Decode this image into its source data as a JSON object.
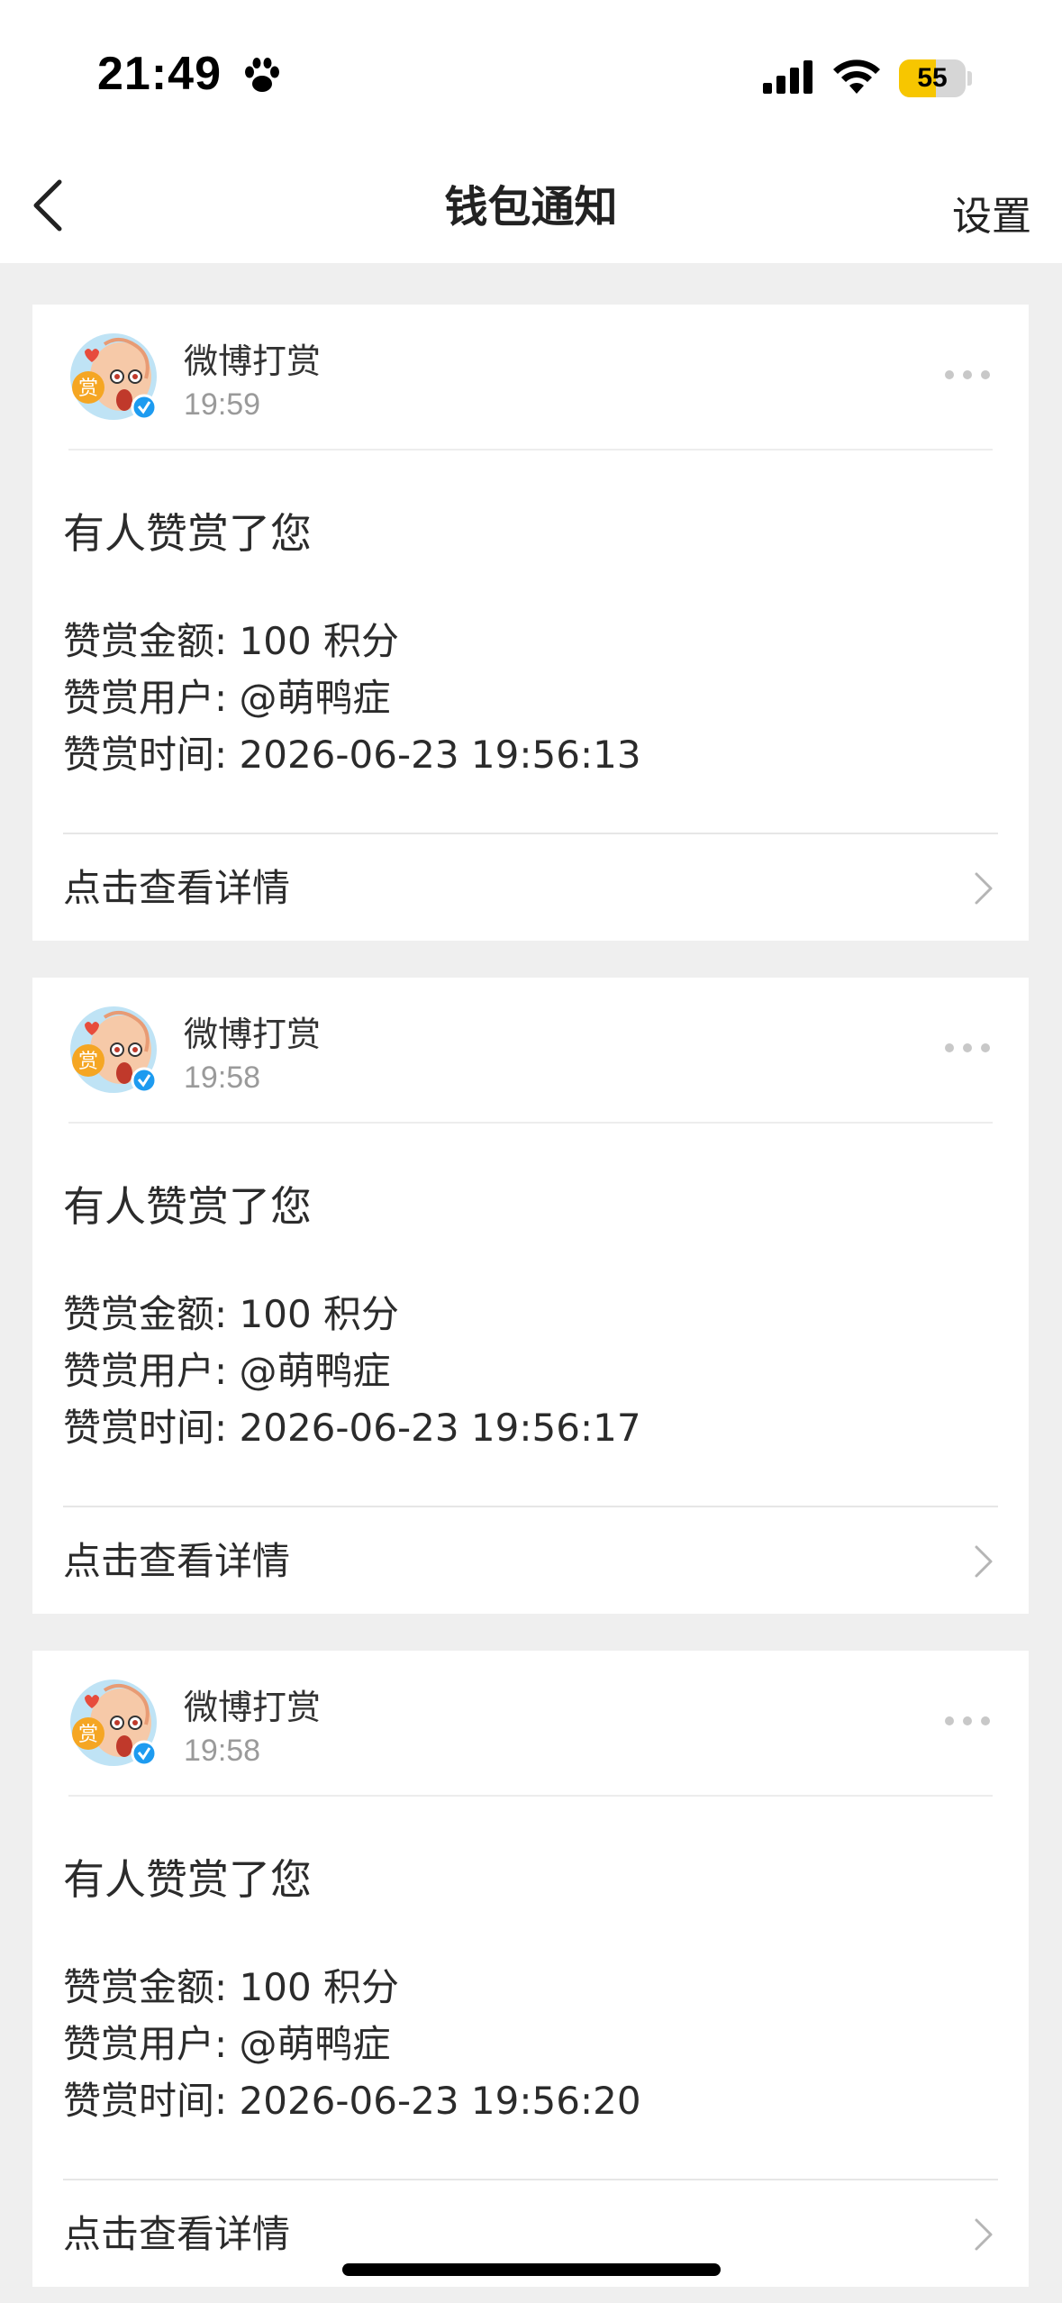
{
  "status_bar": {
    "time": "21:49",
    "battery_level": "55",
    "battery_fraction": 0.55,
    "icons": [
      "paw-icon",
      "signal-icon",
      "wifi-icon",
      "battery-icon"
    ]
  },
  "nav": {
    "title": "钱包通知",
    "settings_label": "设置",
    "back_icon": "chevron-left-icon"
  },
  "colors": {
    "battery_accent": "#f7c600",
    "verified_badge": "#1d9bf0",
    "background": "#efefef"
  },
  "notifications": [
    {
      "sender": "微博打赏",
      "time": "19:59",
      "title": "有人赞赏了您",
      "amount": "赞赏金额: 100 积分",
      "user": "赞赏用户: @萌鸭症",
      "datetime": "赞赏时间: 2026-06-23 19:56:13",
      "detail_label": "点击查看详情"
    },
    {
      "sender": "微博打赏",
      "time": "19:58",
      "title": "有人赞赏了您",
      "amount": "赞赏金额: 100 积分",
      "user": "赞赏用户: @萌鸭症",
      "datetime": "赞赏时间: 2026-06-23 19:56:17",
      "detail_label": "点击查看详情"
    },
    {
      "sender": "微博打赏",
      "time": "19:58",
      "title": "有人赞赏了您",
      "amount": "赞赏金额: 100 积分",
      "user": "赞赏用户: @萌鸭症",
      "datetime": "赞赏时间: 2026-06-23 19:56:20",
      "detail_label": "点击查看详情"
    }
  ]
}
